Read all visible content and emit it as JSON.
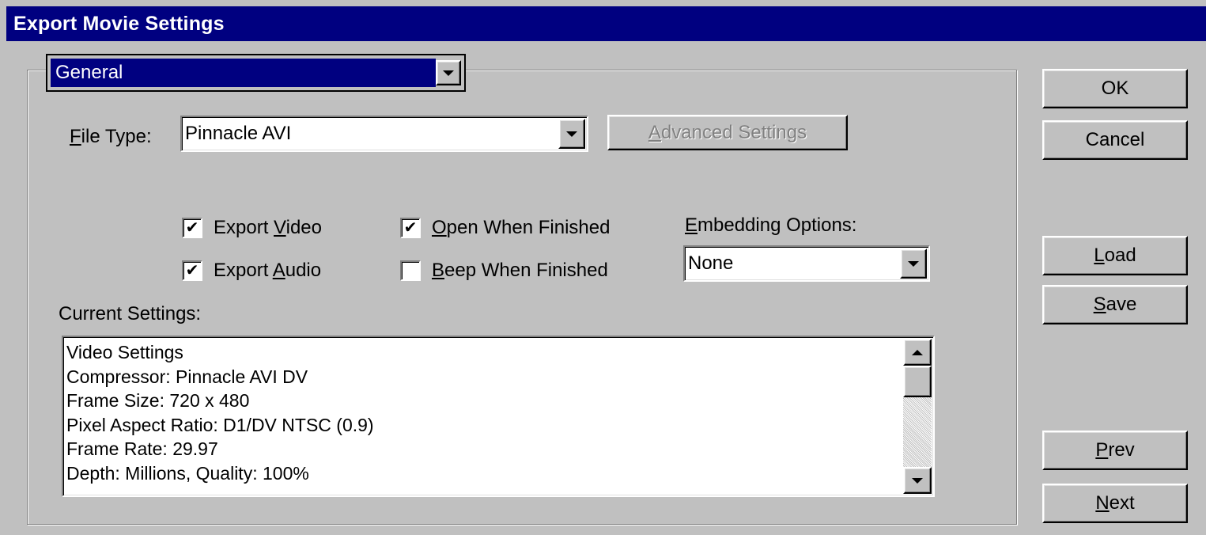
{
  "window": {
    "title": "Export Movie Settings"
  },
  "panel_select": {
    "value": "General"
  },
  "file_type": {
    "label_prefix": "",
    "label_mnemonic": "F",
    "label_rest": "ile Type:",
    "value": "Pinnacle AVI"
  },
  "advanced_settings": {
    "mnemonic": "A",
    "rest": "dvanced Settings"
  },
  "checkboxes": {
    "export_video": {
      "prefix": "Export ",
      "mnemonic": "V",
      "rest": "ideo",
      "checked": true
    },
    "export_audio": {
      "prefix": "Export ",
      "mnemonic": "A",
      "rest": "udio",
      "checked": true
    },
    "open_when_finished": {
      "prefix": "",
      "mnemonic": "O",
      "rest": "pen When Finished",
      "checked": true
    },
    "beep_when_finished": {
      "prefix": "",
      "mnemonic": "B",
      "rest": "eep When Finished",
      "checked": false
    }
  },
  "embedding": {
    "label_mnemonic": "E",
    "label_rest": "mbedding Options:",
    "value": "None"
  },
  "current_settings": {
    "label": "Current Settings:",
    "lines": [
      "Video Settings",
      "Compressor: Pinnacle AVI DV",
      "Frame Size: 720 x 480",
      "Pixel Aspect Ratio: D1/DV NTSC (0.9)",
      "Frame Rate: 29.97",
      "Depth: Millions, Quality: 100%"
    ]
  },
  "buttons": {
    "ok": "OK",
    "cancel": "Cancel",
    "load": {
      "mnemonic": "L",
      "rest": "oad"
    },
    "save": {
      "mnemonic": "S",
      "rest": "ave"
    },
    "prev": {
      "mnemonic": "P",
      "rest": "rev"
    },
    "next": {
      "mnemonic": "N",
      "rest": "ext"
    }
  },
  "check_glyph": "✔",
  "icons": {
    "dropdown": "chevron-down-icon",
    "scroll_up": "arrow-up-icon",
    "scroll_down": "arrow-down-icon"
  }
}
